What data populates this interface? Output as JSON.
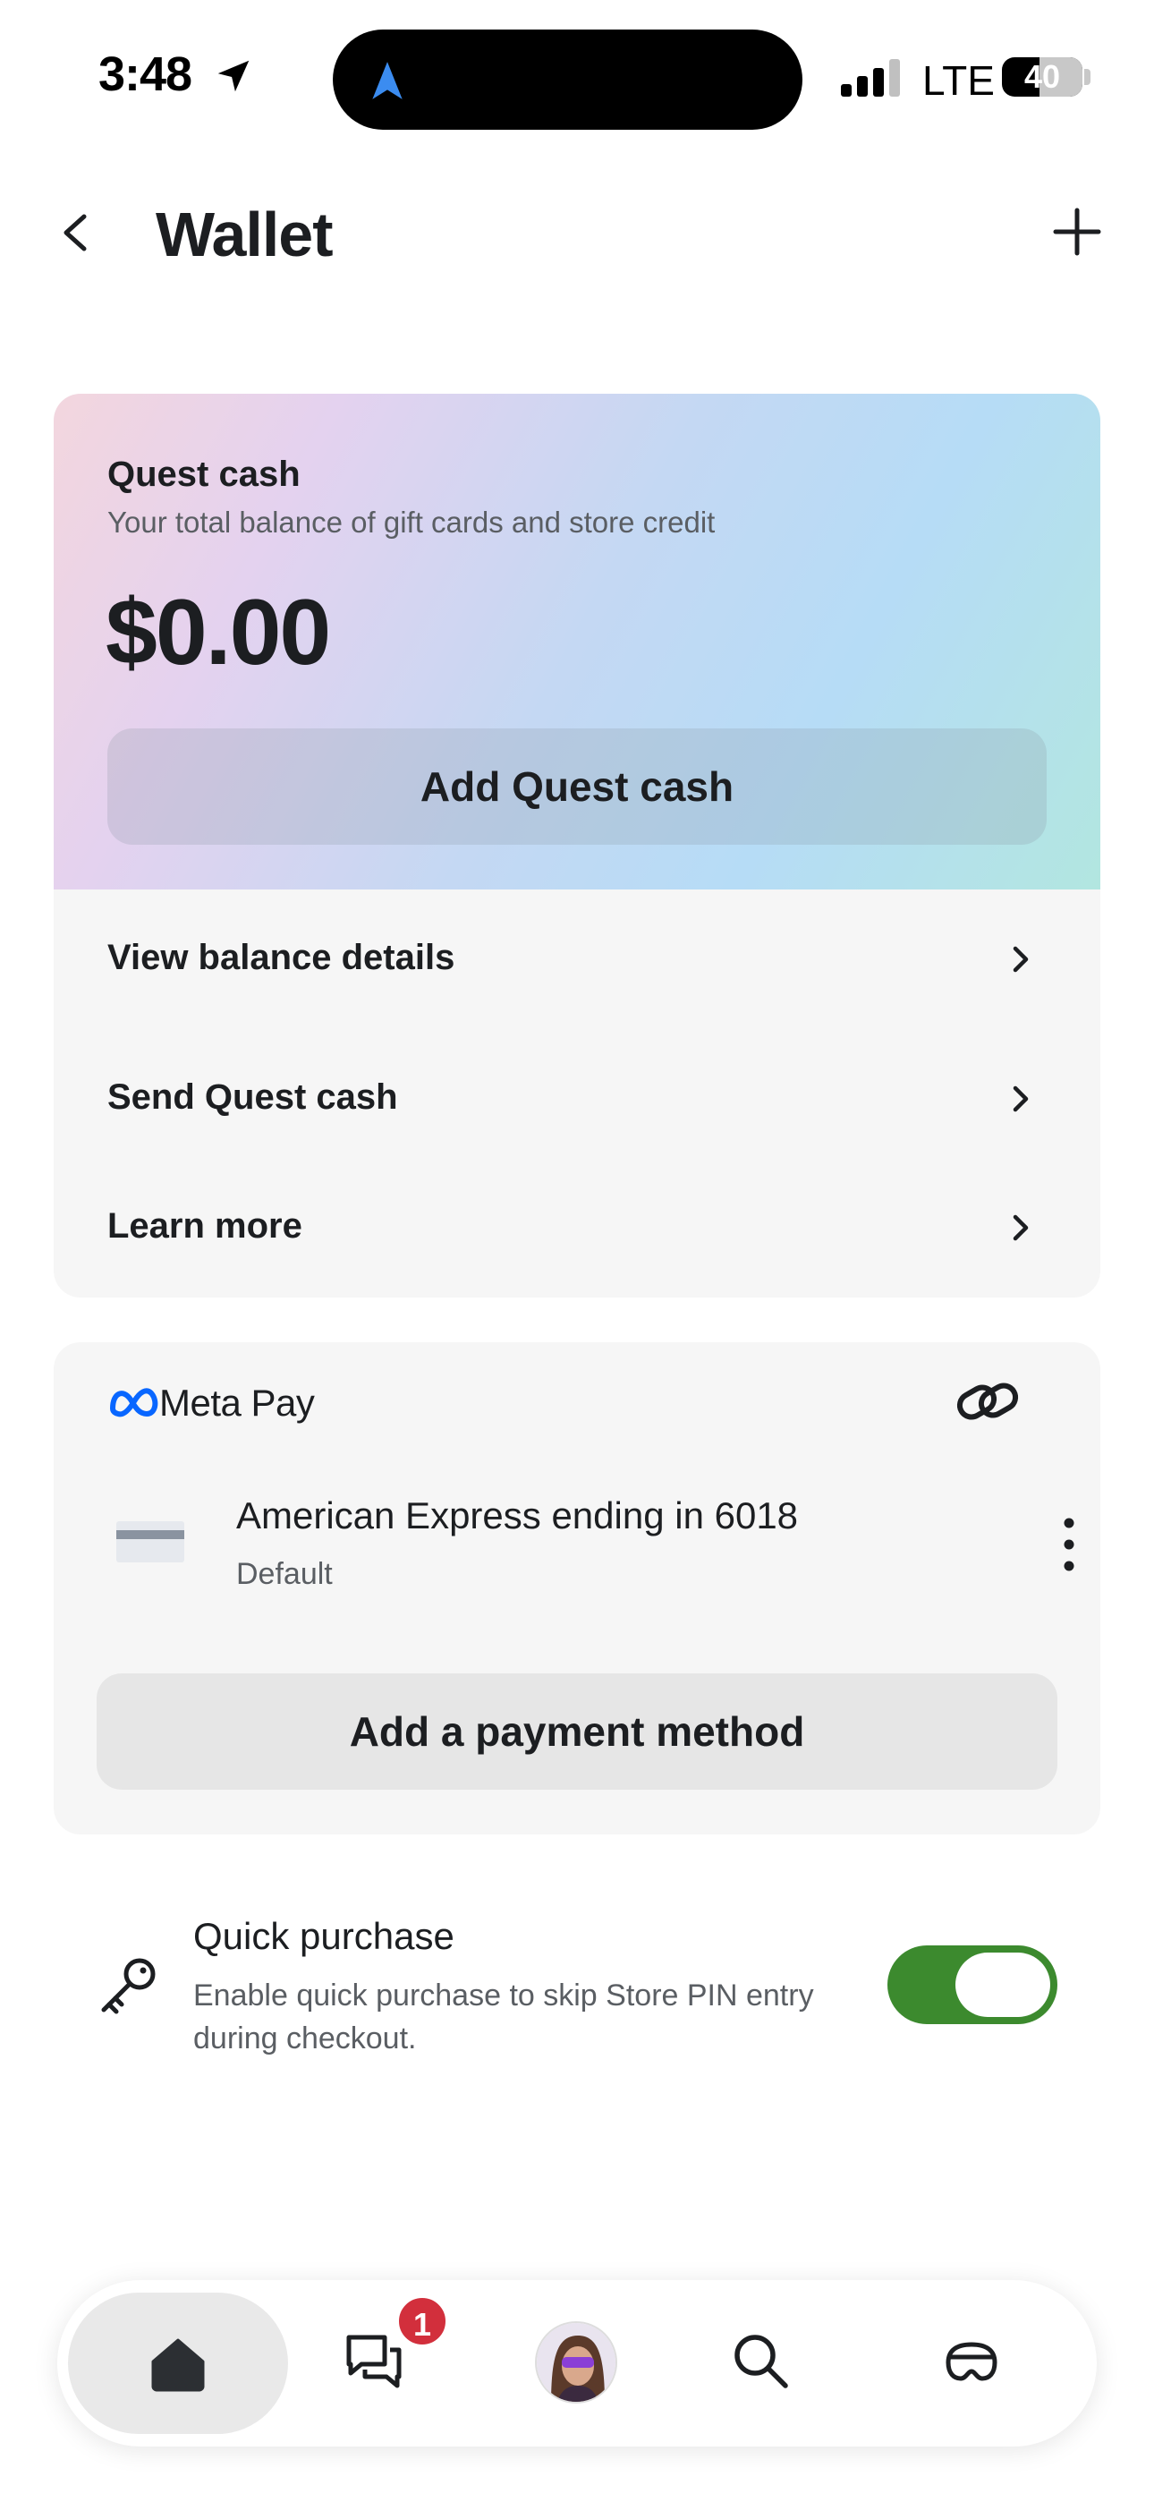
{
  "status_bar": {
    "time": "3:48",
    "network": "LTE",
    "battery": "40"
  },
  "header": {
    "title": "Wallet"
  },
  "quest_cash": {
    "title": "Quest cash",
    "subtitle": "Your total balance of gift cards and store credit",
    "balance": "$0.00",
    "add_button_label": "Add Quest cash",
    "rows": [
      {
        "label": "View balance details"
      },
      {
        "label": "Send Quest cash"
      },
      {
        "label": "Learn more"
      }
    ]
  },
  "meta_pay": {
    "brand_label": "Meta Pay",
    "card": {
      "name": "American Express ending in 6018",
      "status": "Default"
    },
    "add_payment_label": "Add a payment method"
  },
  "quick_purchase": {
    "title": "Quick purchase",
    "description": "Enable quick purchase to skip Store PIN entry during checkout.",
    "enabled": true
  },
  "tab_bar": {
    "items": [
      {
        "icon": "home-icon",
        "active": true
      },
      {
        "icon": "chat-icon",
        "badge": "1"
      },
      {
        "icon": "avatar"
      },
      {
        "icon": "search-icon"
      },
      {
        "icon": "headset-icon"
      }
    ]
  },
  "colors": {
    "toggle_on": "#3c8a2e",
    "badge": "#d22f3c",
    "meta_blue": "#0866ff"
  }
}
